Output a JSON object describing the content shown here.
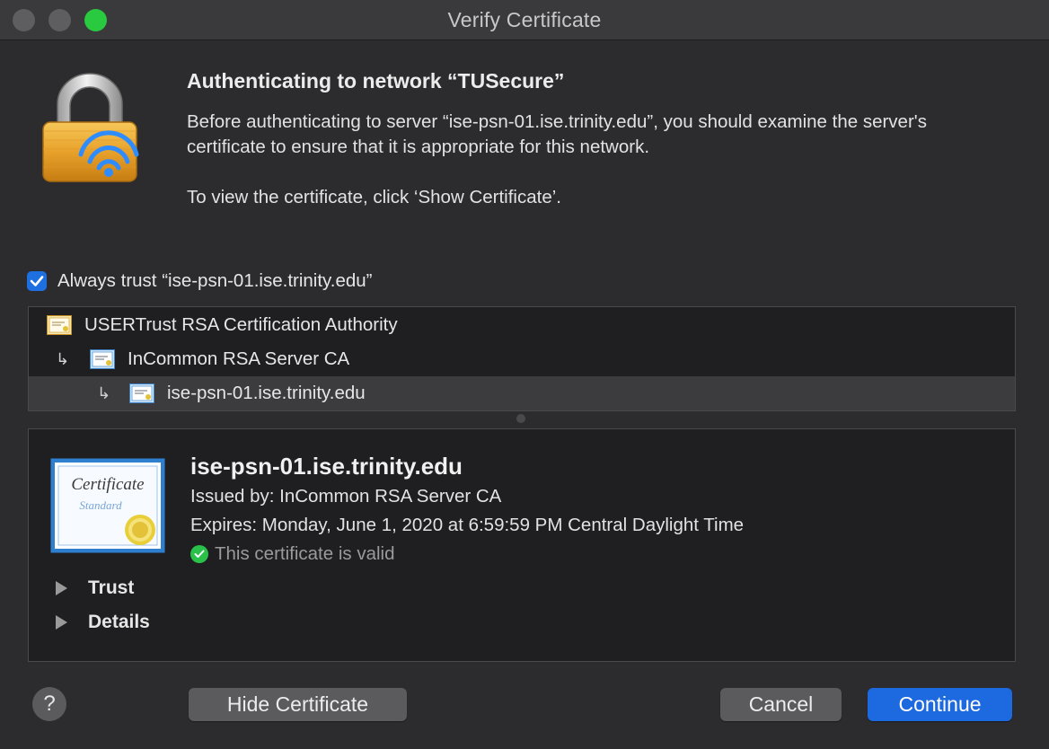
{
  "window": {
    "title": "Verify Certificate"
  },
  "header": {
    "heading": "Authenticating to network “TUSecure”",
    "paragraph1": "Before authenticating to server “ise-psn-01.ise.trinity.edu”, you should examine the server's certificate to ensure that it is appropriate for this network.",
    "paragraph2": "To view the certificate, click ‘Show Certificate’."
  },
  "always_trust": {
    "label": "Always trust “ise-psn-01.ise.trinity.edu”",
    "checked": true
  },
  "chain": {
    "items": [
      {
        "label": "USERTrust RSA Certification Authority",
        "level": 0,
        "selected": false
      },
      {
        "label": "InCommon RSA Server CA",
        "level": 1,
        "selected": false
      },
      {
        "label": "ise-psn-01.ise.trinity.edu",
        "level": 2,
        "selected": true
      }
    ],
    "arrow_glyph": "↳"
  },
  "certificate": {
    "name": "ise-psn-01.ise.trinity.edu",
    "issued_by": "Issued by: InCommon RSA Server CA",
    "expires": "Expires: Monday, June 1, 2020 at 6:59:59 PM Central Daylight Time",
    "status": "This certificate is valid",
    "image_title": "Certificate",
    "image_subtitle": "Standard",
    "sections": [
      {
        "label": "Trust"
      },
      {
        "label": "Details"
      }
    ]
  },
  "buttons": {
    "help": "?",
    "hide_certificate": "Hide Certificate",
    "cancel": "Cancel",
    "continue": "Continue"
  },
  "colors": {
    "accent": "#1d69e0",
    "valid": "#2ac14b",
    "lock_gold": "#e8a22a",
    "wifi_blue": "#2f8cff"
  },
  "icons": {
    "lock": "padlock-wifi-icon",
    "check": "checkmark-icon",
    "cert": "certificate-icon",
    "disclosure": "disclosure-triangle-icon"
  }
}
